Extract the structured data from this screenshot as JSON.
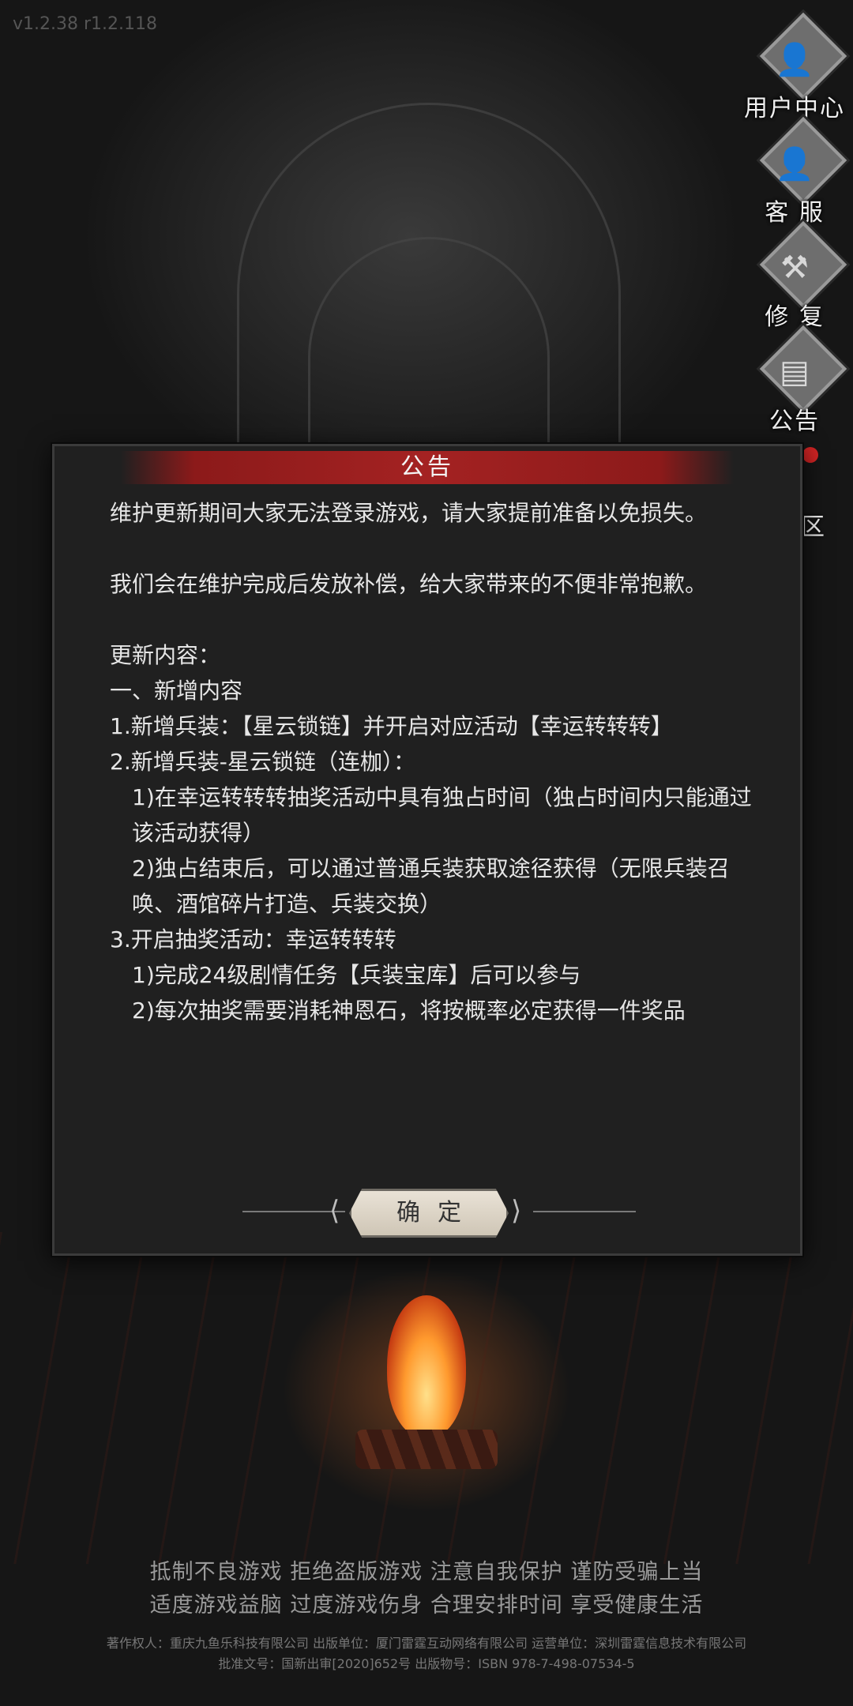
{
  "version": "v1.2.38 r1.2.118",
  "side_menu": [
    {
      "label": "用户中心",
      "icon": "user-icon"
    },
    {
      "label": "客 服",
      "icon": "support-icon"
    },
    {
      "label": "修 复",
      "icon": "repair-icon"
    },
    {
      "label": "公告",
      "icon": "notice-icon"
    }
  ],
  "partial_label": "区",
  "dialog": {
    "title": "公告",
    "lines": [
      "维护更新期间大家无法登录游戏，请大家提前准备以免损失。",
      "",
      "我们会在维护完成后发放补偿，给大家带来的不便非常抱歉。",
      "",
      "更新内容：",
      "一、新增内容",
      "1.新增兵装：【星云锁链】并开启对应活动【幸运转转转】",
      "2.新增兵装-星云锁链（连枷）：",
      "1)在幸运转转转抽奖活动中具有独占时间（独占时间内只能通过该活动获得）",
      "2)独占结束后，可以通过普通兵装获取途径获得（无限兵装召唤、酒馆碎片打造、兵装交换）",
      "3.开启抽奖活动：幸运转转转",
      "1)完成24级剧情任务【兵装宝库】后可以参与",
      "2)每次抽奖需要消耗神恩石，将按概率必定获得一件奖品"
    ],
    "confirm_label": "确定"
  },
  "health_notice": [
    "抵制不良游戏 拒绝盗版游戏 注意自我保护 谨防受骗上当",
    "适度游戏益脑 过度游戏伤身 合理安排时间 享受健康生活"
  ],
  "copyright": [
    "著作权人：重庆九鱼乐科技有限公司 出版单位：厦门雷霆互动网络有限公司 运营单位：深圳雷霆信息技术有限公司",
    "批准文号：国新出审[2020]652号 出版物号：ISBN 978-7-498-07534-5"
  ]
}
